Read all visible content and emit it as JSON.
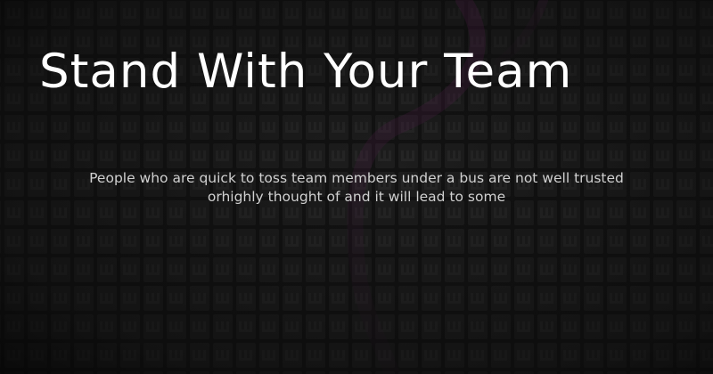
{
  "post": {
    "title": "Stand With Your Team",
    "excerpt": "People who are quick to toss team members under a bus are not well trusted orhighly thought of and it will lead to some"
  },
  "colors": {
    "background": "#161616",
    "tile": "#1f1f1f",
    "tile_detail": "#262626",
    "accent_glow": "#5a1f4e",
    "title_text": "#ffffff",
    "excerpt_text": "#d0d0d0"
  }
}
